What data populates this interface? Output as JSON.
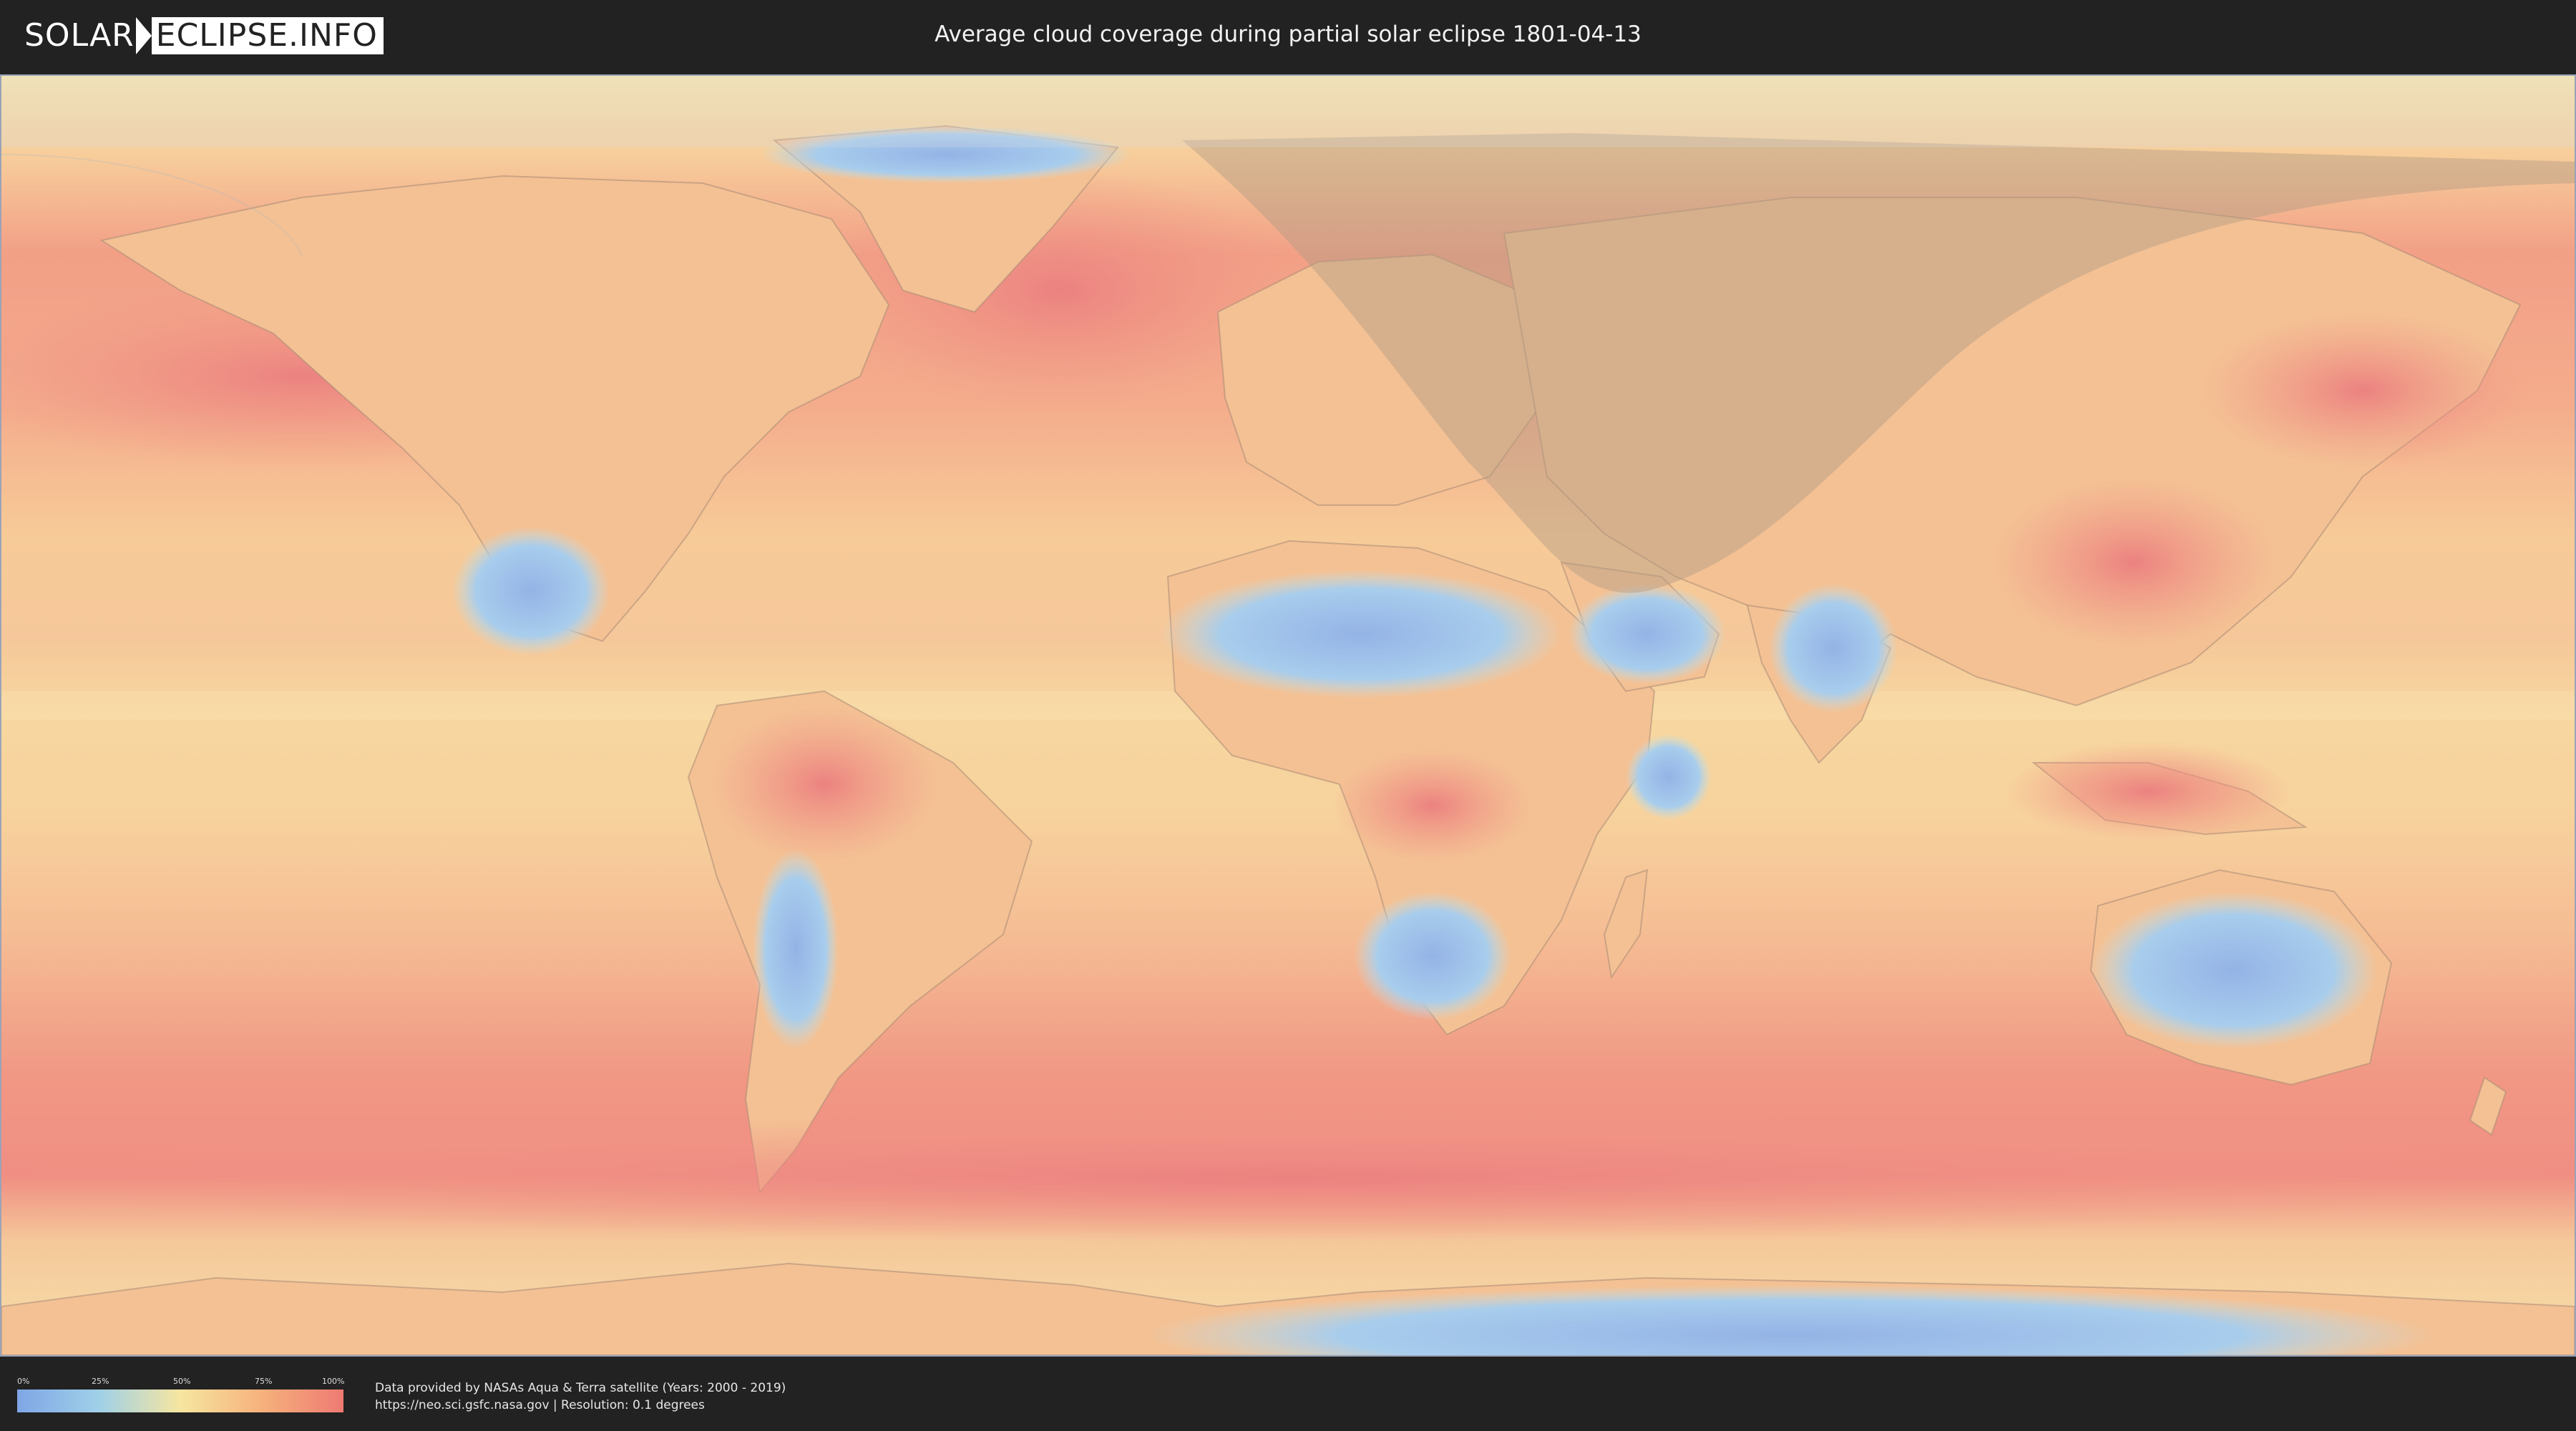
{
  "header": {
    "logo_left": "SOLAR",
    "logo_right": "ECLIPSE.INFO",
    "title": "Average cloud coverage during partial solar eclipse 1801-04-13"
  },
  "legend": {
    "ticks": [
      "0%",
      "25%",
      "50%",
      "75%",
      "100%"
    ],
    "colors": [
      "#7fa6e6",
      "#9fd0e8",
      "#f6e6a0",
      "#f6b17c",
      "#ee7a72"
    ]
  },
  "footer": {
    "credit_line1": "Data provided by NASAs Aqua & Terra satellite (Years: 2000 - 2019)",
    "credit_line2": "https://neo.sci.gsfc.nasa.gov | Resolution: 0.1 degrees"
  },
  "map": {
    "ocean_color": "#f3a27d",
    "land_color": "#f0bf86",
    "clear_sky_color": "#8fb2e6",
    "eclipse_shade_color": "#b49878"
  }
}
